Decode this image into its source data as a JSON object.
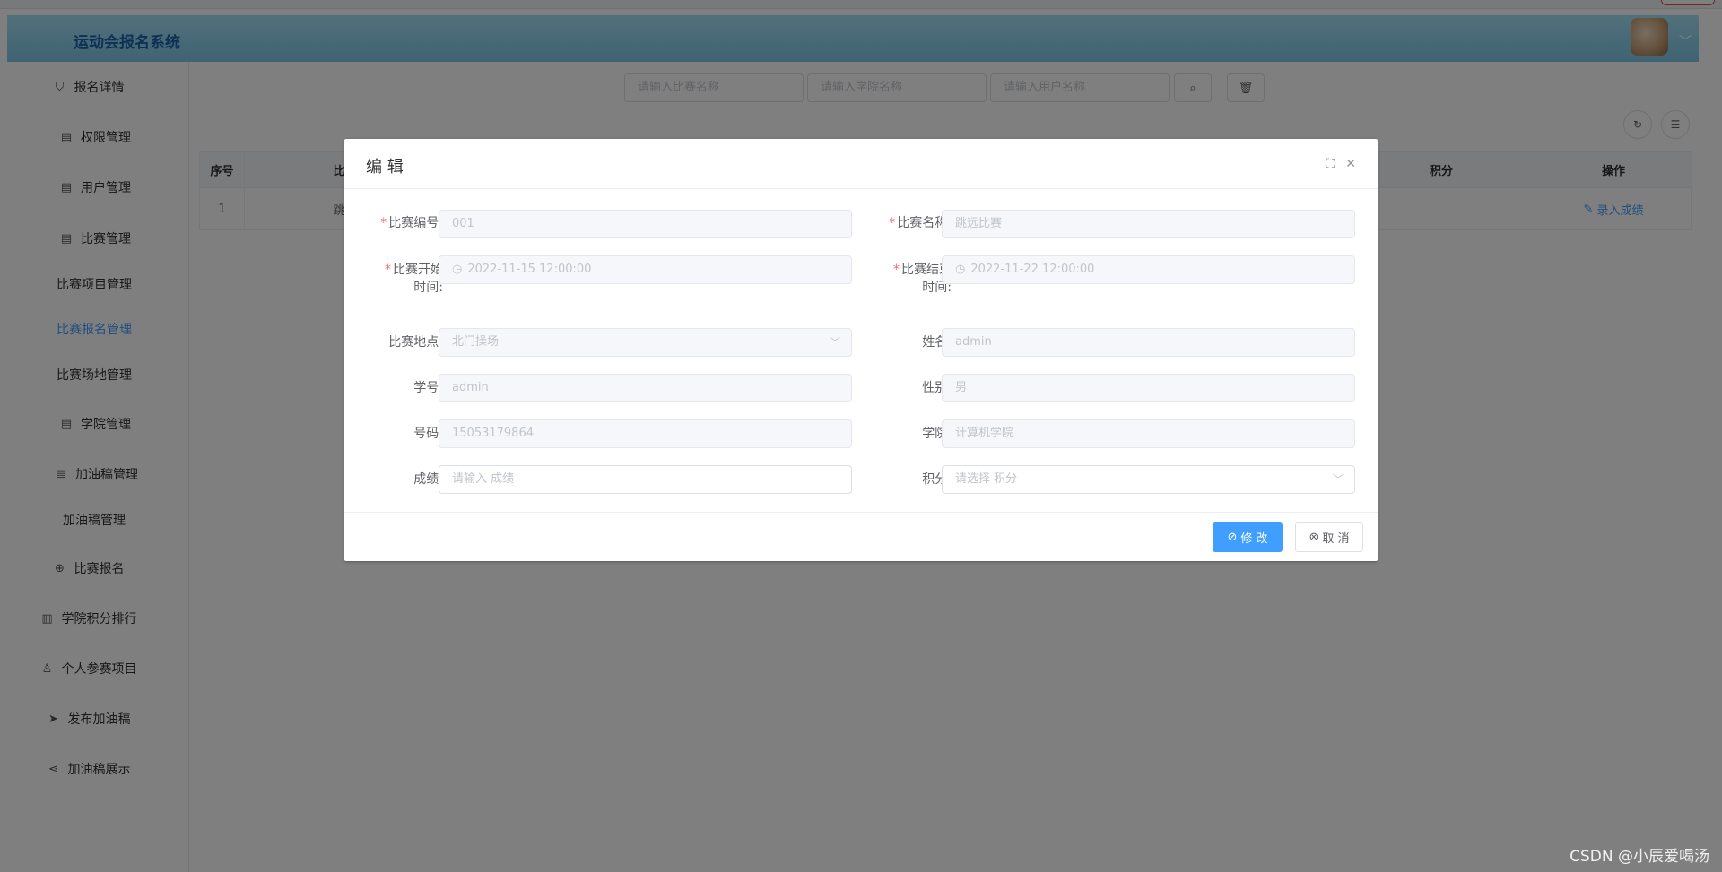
{
  "app": {
    "title": "运动会报名系统"
  },
  "sidebar": {
    "items": [
      {
        "label": "报名详情",
        "icon": "shield-icon"
      },
      {
        "label": "权限管理",
        "icon": "doc-icon",
        "arrow": "﹀"
      },
      {
        "label": "用户管理",
        "icon": "doc-icon",
        "arrow": "﹀"
      },
      {
        "label": "比赛管理",
        "icon": "doc-icon",
        "arrow": "︿"
      },
      {
        "label": "比赛项目管理"
      },
      {
        "label": "比赛报名管理"
      },
      {
        "label": "比赛场地管理"
      },
      {
        "label": "学院管理",
        "icon": "doc-icon",
        "arrow": "﹀"
      },
      {
        "label": "加油稿管理",
        "icon": "doc-icon",
        "arrow": "︿"
      },
      {
        "label": "加油稿管理"
      },
      {
        "label": "比赛报名",
        "icon": "plus-circle-icon"
      },
      {
        "label": "学院积分排行",
        "icon": "bar-chart-icon"
      },
      {
        "label": "个人参赛项目",
        "icon": "user-icon"
      },
      {
        "label": "发布加油稿",
        "icon": "send-icon"
      },
      {
        "label": "加油稿展示",
        "icon": "share-icon"
      }
    ]
  },
  "search": {
    "match_placeholder": "请输入比赛名称",
    "college_placeholder": "请输入学院名称",
    "user_placeholder": "请输入用户名称"
  },
  "table": {
    "headers": {
      "index": "序号",
      "match_name": "比赛名称",
      "score": "积分",
      "actions": "操作"
    },
    "rows": [
      {
        "index": "1",
        "match_name": "跳远比赛",
        "action": "录入成绩"
      }
    ]
  },
  "dialog": {
    "title": "编 辑",
    "fields": {
      "match_no": {
        "label": "比赛编号:",
        "value": "001"
      },
      "match_name": {
        "label": "比赛名称:",
        "value": "跳远比赛"
      },
      "start_time": {
        "label1": "比赛开始",
        "label2": "时间:",
        "value": "2022-11-15 12:00:00"
      },
      "end_time": {
        "label1": "比赛结束",
        "label2": "时间:",
        "value": "2022-11-22 12:00:00"
      },
      "location": {
        "label": "比赛地点:",
        "value": "北门操场"
      },
      "name": {
        "label": "姓名:",
        "value": "admin"
      },
      "student_no": {
        "label": "学号:",
        "value": "admin"
      },
      "gender": {
        "label": "性别:",
        "value": "男"
      },
      "phone": {
        "label": "号码:",
        "value": "15053179864"
      },
      "college": {
        "label": "学院:",
        "value": "计算机学院"
      },
      "result": {
        "label": "成绩:",
        "placeholder": "请输入 成绩"
      },
      "points": {
        "label": "积分:",
        "placeholder": "请选择 积分"
      }
    },
    "buttons": {
      "confirm": "修 改",
      "cancel": "取 消"
    }
  },
  "watermark": "CSDN @小辰爱喝汤",
  "colors": {
    "primary": "#409eff",
    "header_start": "#a3e1f5",
    "header_end": "#7ec7e6",
    "title": "#1e5fa8",
    "required": "#f56c6c"
  }
}
